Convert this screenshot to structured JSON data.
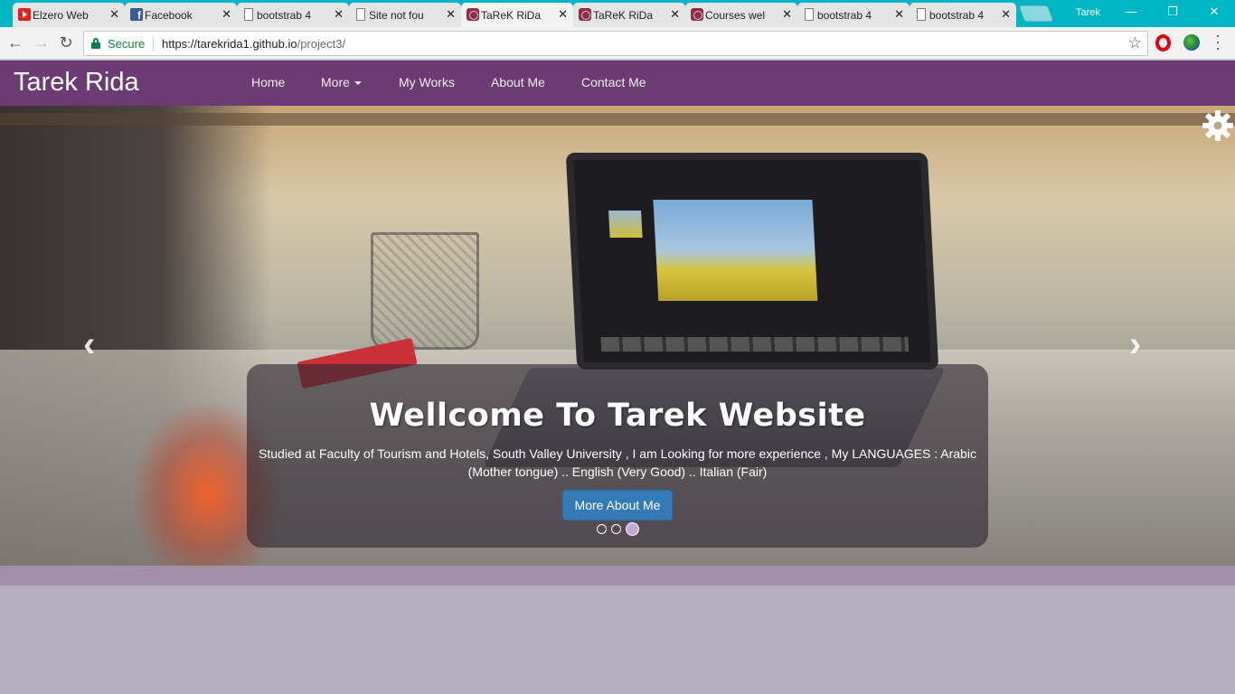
{
  "browser": {
    "tabs": [
      {
        "title": "Elzero Web",
        "favicon": "youtube-icon"
      },
      {
        "title": "Facebook",
        "favicon": "facebook-icon"
      },
      {
        "title": "bootstrab 4",
        "favicon": "document-icon"
      },
      {
        "title": "Site not fou",
        "favicon": "document-icon"
      },
      {
        "title": "TaReK RiDa",
        "favicon": "site-logo-icon",
        "active": true
      },
      {
        "title": "TaReK RiDa",
        "favicon": "site-logo-icon"
      },
      {
        "title": "Courses wel",
        "favicon": "site-logo-icon"
      },
      {
        "title": "bootstrab 4",
        "favicon": "document-icon"
      },
      {
        "title": "bootstrab 4",
        "favicon": "document-icon"
      }
    ],
    "profile_name": "Tarek",
    "secure_label": "Secure",
    "url_host": "https://tarekrida1.github.io",
    "url_path": "/project3/"
  },
  "site": {
    "brand": "Tarek Rida",
    "nav": {
      "home": "Home",
      "more": "More",
      "my_works": "My Works",
      "about_me": "About Me",
      "contact_me": "Contact Me"
    },
    "accent_color": "#6d3b73"
  },
  "carousel": {
    "heading": "Wellcome To Tarek Website",
    "text": "Studied at Faculty of Tourism and Hotels, South Valley University , I am Looking for more experience , My LANGUAGES : Arabic (Mother tongue) .. English (Very Good) .. Italian (Fair)",
    "button_label": "More About Me",
    "slide_count": 3,
    "active_slide": 3
  }
}
